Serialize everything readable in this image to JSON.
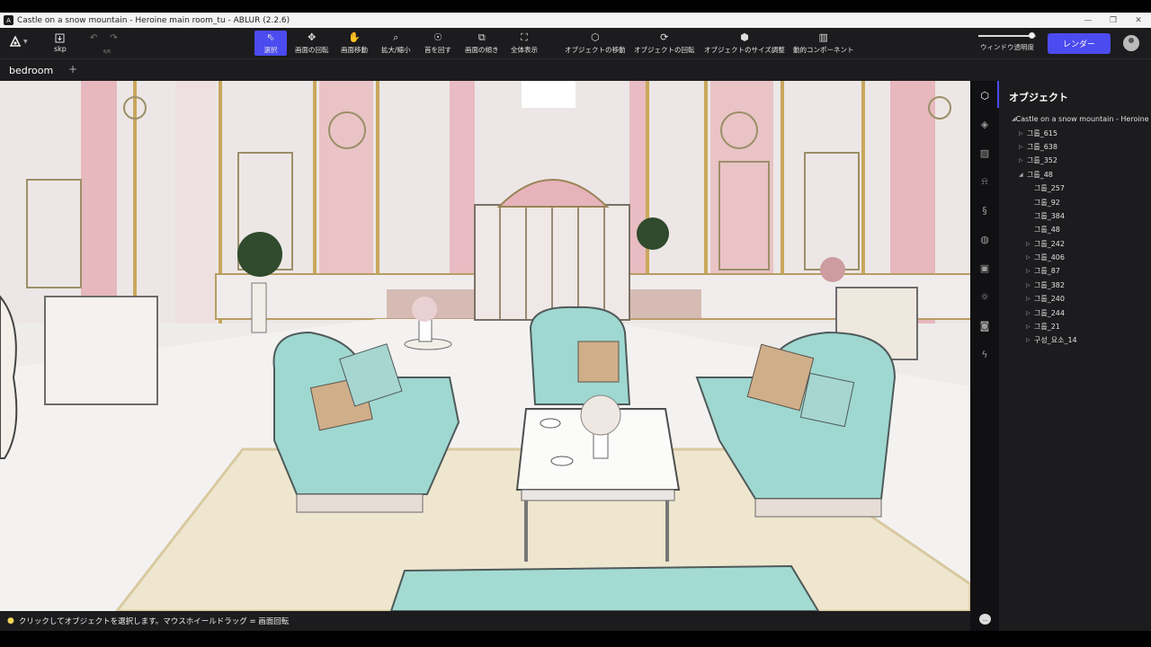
{
  "window": {
    "title": "Castle on a snow mountain - Heroine main room_tu - ABLUR (2.2.6)",
    "logo": "A",
    "minimize": "—",
    "restore": "❐",
    "close": "✕"
  },
  "toolbar": {
    "file_type": "skp",
    "undo_count": "6/6",
    "tools": [
      {
        "label": "選択",
        "icon": "cursor-icon"
      },
      {
        "label": "画面の回転",
        "icon": "orbit-icon"
      },
      {
        "label": "画面移動",
        "icon": "hand-icon"
      },
      {
        "label": "拡大/縮小",
        "icon": "zoom-icon"
      },
      {
        "label": "首を回す",
        "icon": "look-around-icon"
      },
      {
        "label": "画面の傾き",
        "icon": "tilt-icon"
      },
      {
        "label": "全体表示",
        "icon": "zoom-extents-icon"
      },
      {
        "label": "オブジェクトの移動",
        "icon": "move-object-icon"
      },
      {
        "label": "オブジェクトの回転",
        "icon": "rotate-object-icon"
      },
      {
        "label": "オブジェクトのサイズ調整",
        "icon": "scale-object-icon"
      },
      {
        "label": "動的コンポーネント",
        "icon": "dynamic-component-icon"
      }
    ],
    "window_opacity_label": "ウィンドウ透明度",
    "window_opacity": 0.92,
    "render_label": "レンダー",
    "accent_color": "#4b4bf0"
  },
  "tabs": {
    "items": [
      "bedroom"
    ],
    "add": "+"
  },
  "statusbar": {
    "hint": "クリックしてオブジェクトを選択します。マウスホイールドラッグ = 画面回転"
  },
  "panel": {
    "title": "オブジェクト",
    "tree": [
      {
        "label": "Castle on a snow mountain - Heroine main room_tu",
        "depth": 0,
        "state": "expanded"
      },
      {
        "label": "그룹_615",
        "depth": 1,
        "state": "collapsed"
      },
      {
        "label": "그룹_638",
        "depth": 1,
        "state": "collapsed"
      },
      {
        "label": "그룹_352",
        "depth": 1,
        "state": "collapsed"
      },
      {
        "label": "그룹_48",
        "depth": 1,
        "state": "expanded"
      },
      {
        "label": "그룹_257",
        "depth": 2,
        "state": "leaf"
      },
      {
        "label": "그룹_92",
        "depth": 2,
        "state": "leaf"
      },
      {
        "label": "그룹_384",
        "depth": 2,
        "state": "leaf"
      },
      {
        "label": "그룹_48",
        "depth": 2,
        "state": "leaf"
      },
      {
        "label": "그룹_242",
        "depth": 2,
        "state": "collapsed"
      },
      {
        "label": "그룹_406",
        "depth": 2,
        "state": "collapsed"
      },
      {
        "label": "그룹_87",
        "depth": 2,
        "state": "collapsed"
      },
      {
        "label": "그룹_382",
        "depth": 2,
        "state": "collapsed"
      },
      {
        "label": "그룹_240",
        "depth": 2,
        "state": "collapsed"
      },
      {
        "label": "그룹_244",
        "depth": 2,
        "state": "collapsed"
      },
      {
        "label": "그룹_21",
        "depth": 2,
        "state": "collapsed"
      },
      {
        "label": "구성_요소_14",
        "depth": 2,
        "state": "collapsed"
      }
    ]
  },
  "rail": [
    "object-cube-icon",
    "layers-icon",
    "material-icon",
    "person-icon",
    "path-icon",
    "globe-icon",
    "image-icon",
    "sun-icon",
    "camera-icon",
    "lightning-icon"
  ]
}
